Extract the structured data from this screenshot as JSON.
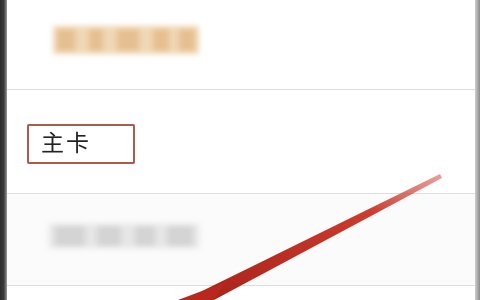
{
  "list": {
    "items": [
      {
        "label": "",
        "redacted": true
      },
      {
        "label": "主卡",
        "highlighted": true
      },
      {
        "label": "",
        "redacted": true
      },
      {
        "label": ""
      }
    ]
  },
  "colors": {
    "highlight_border": "#b05a4e",
    "arrow": "#c0392b",
    "redaction_top": "#efd3ad",
    "redaction_bottom": "#e6e6e6",
    "divider": "#dddddd"
  },
  "annotation": {
    "icon": "red-pointer-arrow"
  }
}
